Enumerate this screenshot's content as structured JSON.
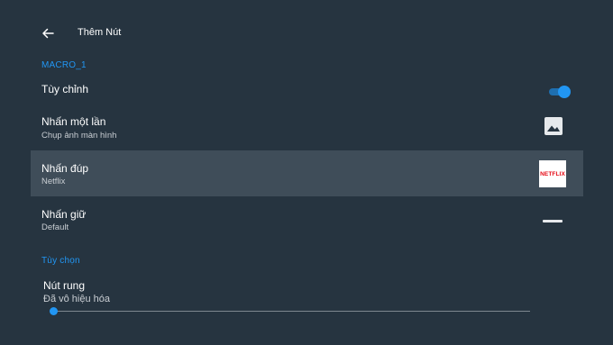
{
  "header": {
    "title": "Thêm Nút",
    "back_icon": "arrow-left-icon"
  },
  "sections": {
    "macro_header": "MACRO_1",
    "options_header": "Tùy chọn"
  },
  "rows": {
    "custom": {
      "title": "Tùy chỉnh",
      "toggle_on": true
    },
    "single_press": {
      "title": "Nhấn một lần",
      "subtitle": "Chụp ảnh màn hình",
      "icon": "image-icon"
    },
    "double_press": {
      "title": "Nhấn đúp",
      "subtitle": "Netflix",
      "logo_text": "NETFLIX"
    },
    "long_press": {
      "title": "Nhấn giữ",
      "subtitle": "Default",
      "icon": "dash-icon"
    },
    "vibration": {
      "title": "Nút rung",
      "subtitle": "Đã vô hiệu hóa",
      "slider_value": 0
    }
  },
  "colors": {
    "background": "#263440",
    "selected_row": "#3f4d59",
    "accent": "#2196f3",
    "netflix_red": "#e50914"
  }
}
